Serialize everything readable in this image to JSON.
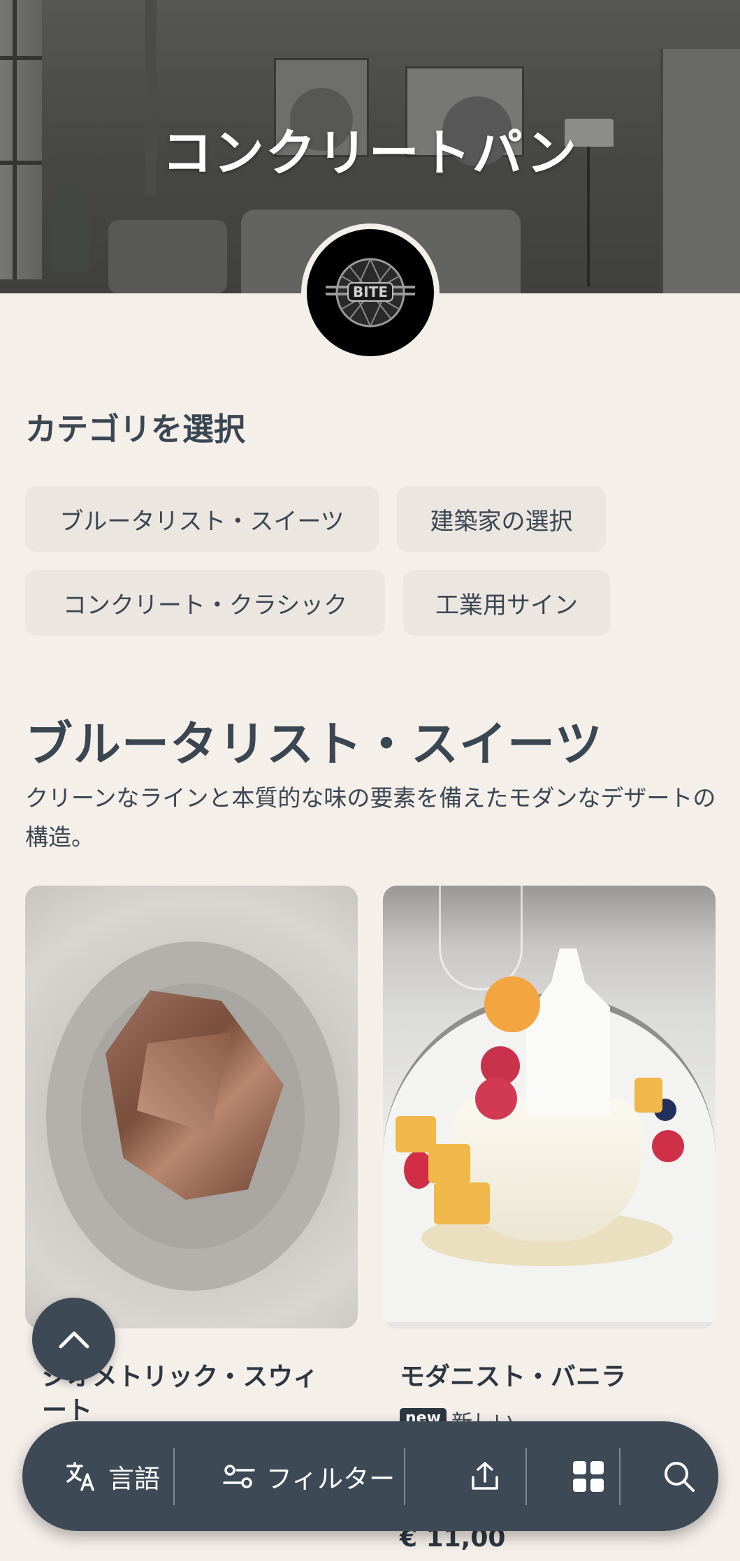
{
  "restaurant": {
    "name": "コンクリートパン",
    "logo_text": "BITE"
  },
  "categories": {
    "heading": "カテゴリを選択",
    "items": [
      "ブルータリスト・スイーツ",
      "建築家の選択",
      "コンクリート・クラシック",
      "工業用サイン"
    ]
  },
  "section": {
    "title": "ブルータリスト・スイーツ",
    "description": "クリーンなラインと本質的な味の要素を備えたモダンなデザートの構造。"
  },
  "products": [
    {
      "name": "ジオメトリック・スウィート"
    },
    {
      "name": "モダニスト・バニラ",
      "badge": "new",
      "badge_label": "新しい",
      "price": "€ 11,00"
    }
  ],
  "toolbar": {
    "language_label": "言語",
    "filter_label": "フィルター",
    "icons": [
      "translate-icon",
      "filter-icon",
      "share-icon",
      "grid-icon",
      "search-icon"
    ]
  },
  "colors": {
    "background": "#f5efea",
    "chip": "#ece6e1",
    "text": "#3a4652",
    "toolbar": "#3d4955"
  }
}
